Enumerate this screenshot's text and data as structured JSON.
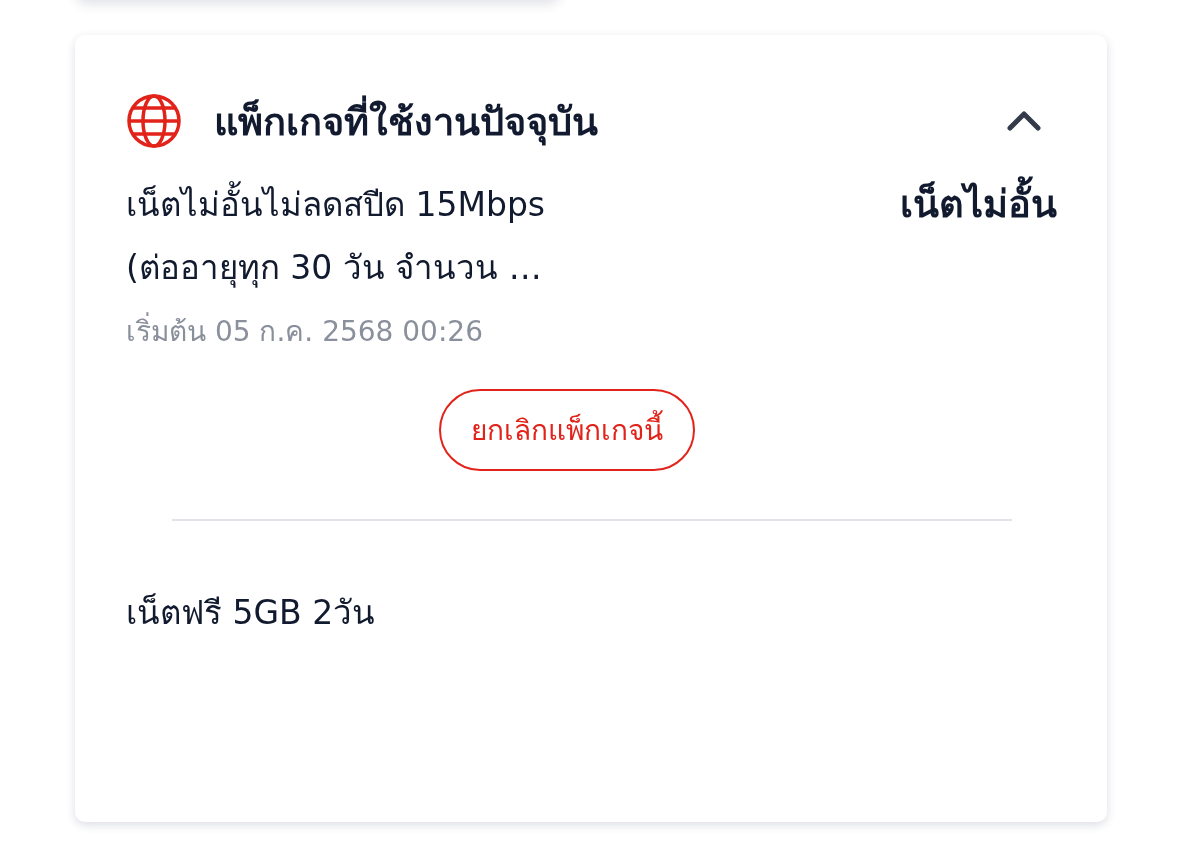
{
  "header": {
    "title": "แพ็กเกจที่ใช้งานปัจจุบัน",
    "expanded": true
  },
  "packages": [
    {
      "name_lines": [
        "เน็ตไม่อั้นไม่ลดสปีด 15Mbps",
        "(ต่ออายุทุก 30 วัน จำนวน …"
      ],
      "type_label": "เน็ตไม่อั้น",
      "start": "เริ่มต้น 05 ก.ค. 2568 00:26",
      "action": "ยกเลิกแพ็กเกจนี้"
    },
    {
      "name_lines": [
        "เน็ตฟรี 5GB 2วัน"
      ]
    }
  ]
}
